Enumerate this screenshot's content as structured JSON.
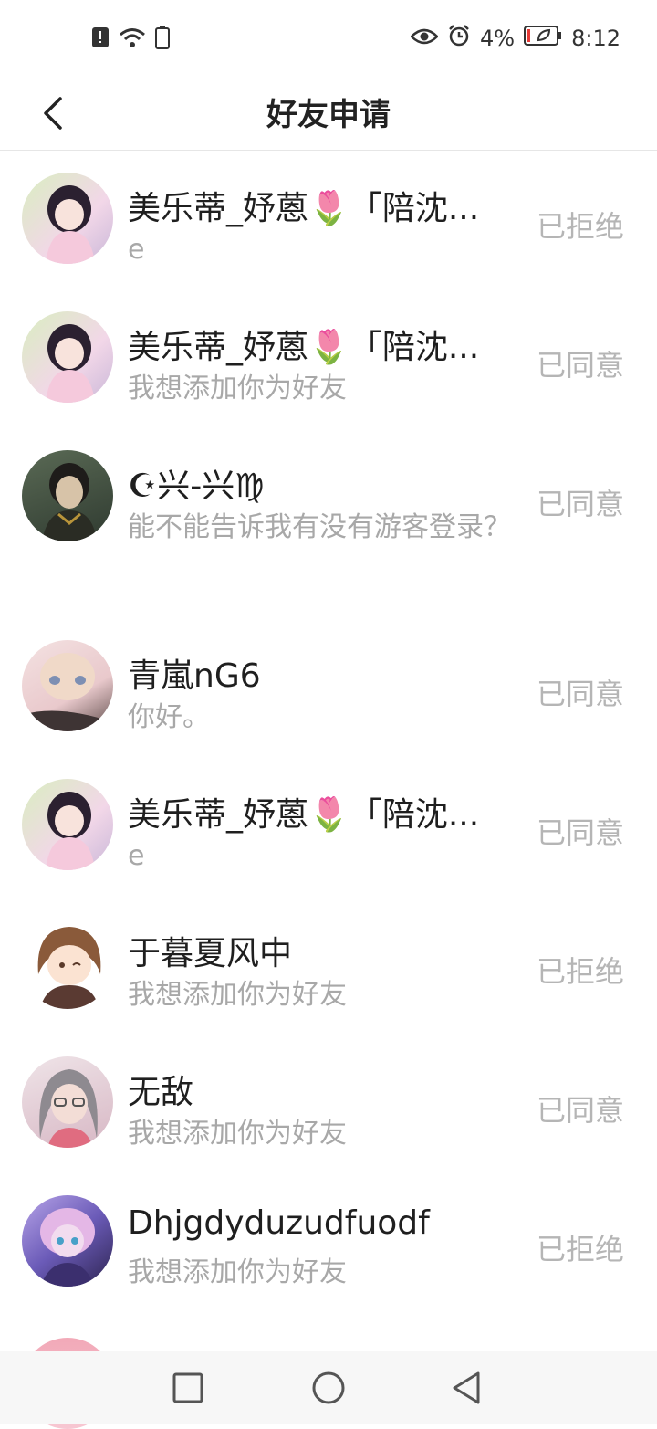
{
  "status_bar": {
    "battery_percent": "4%",
    "time": "8:12"
  },
  "header": {
    "title": "好友申请"
  },
  "requests": [
    {
      "name": "美乐蒂_妤蒽🌷「陪沈...",
      "message": "e",
      "status": "已拒绝"
    },
    {
      "name": "美乐蒂_妤蒽🌷「陪沈...",
      "message": "我想添加你为好友",
      "status": "已同意"
    },
    {
      "name": "☪兴-兴♍",
      "message": "能不能告诉我有没有游客登录？",
      "status": "已同意"
    },
    {
      "name": "青嵐nG6",
      "message": "你好。",
      "status": "已同意"
    },
    {
      "name": "美乐蒂_妤蒽🌷「陪沈...",
      "message": "e",
      "status": "已同意"
    },
    {
      "name": "于暮夏风中",
      "message": "我想添加你为好友",
      "status": "已拒绝"
    },
    {
      "name": "无敌",
      "message": "我想添加你为好友",
      "status": "已同意"
    },
    {
      "name": "Dhjgdyduzudfuodf",
      "message": "我想添加你为好友",
      "status": "已拒绝"
    }
  ],
  "colors": {
    "status_text": "#b5b5b5",
    "message_text": "#a8a8a8"
  }
}
